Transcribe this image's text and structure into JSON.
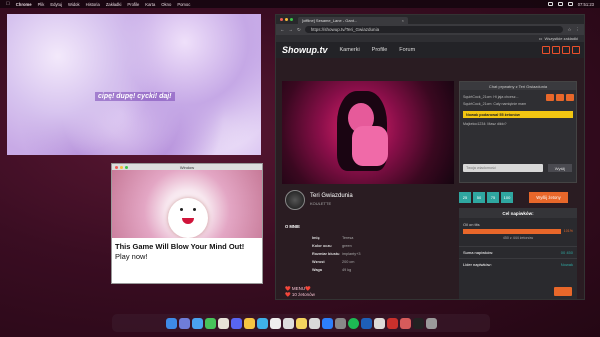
{
  "menubar": {
    "app": "Chrome",
    "items": [
      "Plik",
      "Edytuj",
      "Widok",
      "Historia",
      "Zakładki",
      "Profile",
      "Karta",
      "Okno",
      "Pomoc"
    ],
    "clock": "07:51:23"
  },
  "bgwindow": {
    "caption": "cipę! dupę! cycki! daj!"
  },
  "adwindow": {
    "title": "Window",
    "headline": "This Game Will Blow Your Mind Out!",
    "cta": "Play now!"
  },
  "browser": {
    "tab_title": "[offline] Sesame_Lane - Gant...",
    "url": "https://showup.tv/Teri_Gwiazdunia",
    "bookmarks": "Wszystkie zakładki",
    "nav": {
      "logo": "Showup.tv",
      "items": [
        "Kamerki",
        "Profile",
        "Forum"
      ]
    },
    "chat": {
      "header": "Chat prywatny z Teri Gwiazdunia",
      "messages": [
        "SquirtCock_21cm: Hi jaja chcesz...",
        "SquirtCock_21cm: Cały namiętnie mam",
        "Majkeloo1234: Masz dildo?"
      ],
      "tip_notice": "Nowak podarował 55 żetonów",
      "input_placeholder": "Twoja wiadomość",
      "send": "Wyślij"
    },
    "profile": {
      "name": "Teri Gwiazdunia",
      "sub": "KOULETTE",
      "about_title": "O MNIE",
      "fields": [
        {
          "k": "Imię",
          "v": "Teresa"
        },
        {
          "k": "Kolor oczu",
          "v": "green"
        },
        {
          "k": "Rozmiar biustu",
          "v": "implanty+3"
        },
        {
          "k": "Wzrost",
          "v": "200 cm"
        },
        {
          "k": "Waga",
          "v": "49 kg"
        }
      ],
      "menu_line1": "❤️ MENU❤️",
      "menu_line2": "❤️ 10 żetonów"
    },
    "tips": {
      "buttons": [
        "25",
        "50",
        "75",
        "100"
      ],
      "give": "Wyślij żetony",
      "goal_header": "Cel napiwków:",
      "goal_text": "Oil on tits",
      "goal_pct": "101%",
      "goal_fraction": 1.0,
      "goal_count": "450 z 444 żetonów",
      "sum_label": "Suma napiwków:",
      "sum_value": "00 450",
      "leader_label": "Lider napiwków:",
      "leader_value": "Nowak"
    }
  },
  "colors": {
    "accent": "#e8672a",
    "teal": "#2fa6a0",
    "tip_yellow": "#f2c511"
  }
}
